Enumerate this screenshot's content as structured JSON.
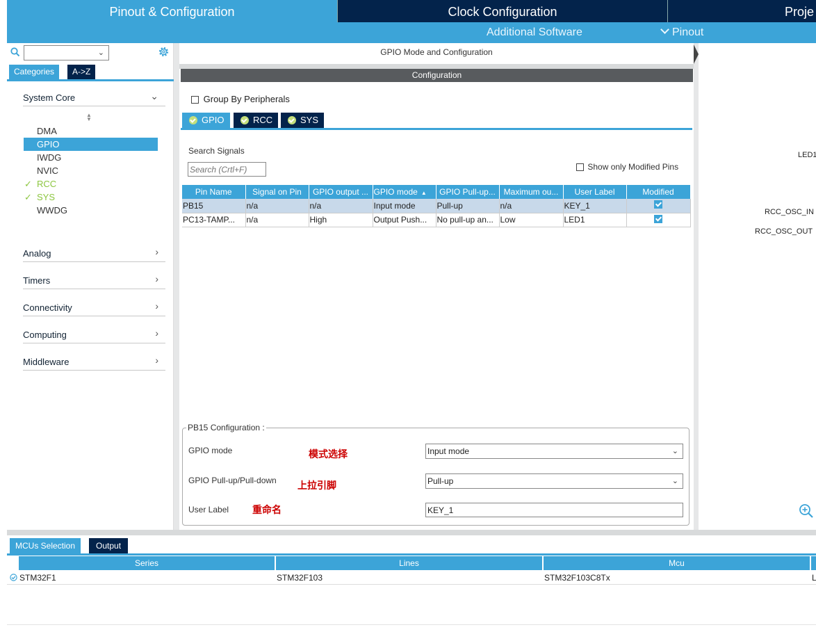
{
  "top_tabs": {
    "pinout": "Pinout & Configuration",
    "clock": "Clock Configuration",
    "project": "Proje"
  },
  "sub_bar": {
    "additional_software": "Additional Software",
    "pinout": "Pinout"
  },
  "left": {
    "tabs": {
      "categories": "Categories",
      "az": "A->Z"
    },
    "system_core": "System Core",
    "core_items": [
      "DMA",
      "GPIO",
      "IWDG",
      "NVIC",
      "RCC",
      "SYS",
      "WWDG"
    ],
    "categories": [
      "Analog",
      "Timers",
      "Connectivity",
      "Computing",
      "Middleware"
    ]
  },
  "center": {
    "title": "GPIO Mode and Configuration",
    "configuration": "Configuration",
    "group_by": "Group By Peripherals",
    "tabs": [
      "GPIO",
      "RCC",
      "SYS"
    ],
    "search_label": "Search Signals",
    "search_placeholder": "Search (Crtl+F)",
    "show_modified": "Show only Modified Pins",
    "table": {
      "headers": [
        "Pin Name",
        "Signal on Pin",
        "GPIO output ...",
        "GPIO mode",
        "GPIO Pull-up...",
        "Maximum ou...",
        "User Label",
        "Modified"
      ],
      "rows": [
        [
          "PB15",
          "n/a",
          "n/a",
          "Input mode",
          "Pull-up",
          "n/a",
          "KEY_1"
        ],
        [
          "PC13-TAMP...",
          "n/a",
          "High",
          "Output Push...",
          "No pull-up an...",
          "Low",
          "LED1"
        ]
      ]
    },
    "pb15": {
      "title": "PB15 Configuration :",
      "gpio_mode_label": "GPIO mode",
      "gpio_mode_value": "Input mode",
      "pull_label": "GPIO Pull-up/Pull-down",
      "pull_value": "Pull-up",
      "user_label_label": "User Label",
      "user_label_value": "KEY_1"
    },
    "annotations": {
      "mode": "模式选择",
      "pull": "上拉引脚",
      "rename": "重命名"
    }
  },
  "right": {
    "labels": [
      "LED1",
      "RCC_OSC_IN",
      "RCC_OSC_OUT"
    ]
  },
  "bottom": {
    "tabs": {
      "mcus": "MCUs Selection",
      "output": "Output"
    },
    "headers": [
      "Series",
      "Lines",
      "Mcu"
    ],
    "row": [
      "STM32F1",
      "STM32F103",
      "STM32F103C8Tx",
      "L"
    ]
  },
  "colors": {
    "accent": "#3ca4d8",
    "dark_navy": "#03234b",
    "ok_green": "#8cc63f",
    "annotation_red": "#cc0000"
  }
}
